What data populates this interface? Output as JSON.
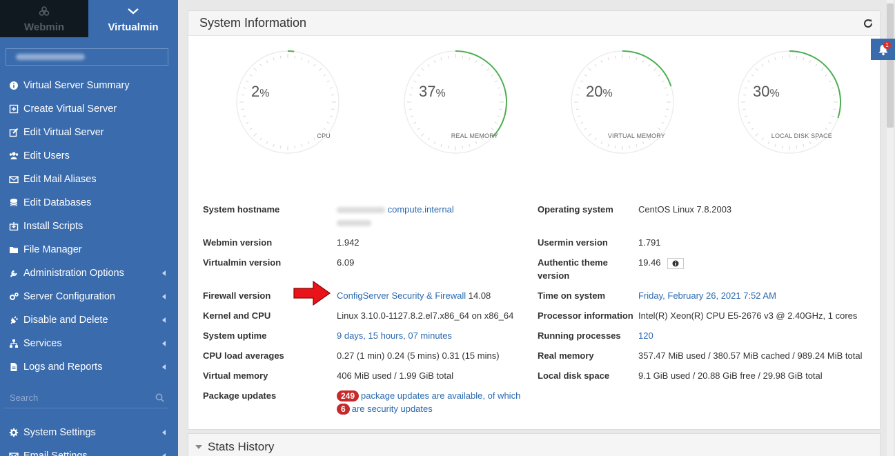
{
  "switcher": {
    "webmin_label": "Webmin",
    "virtualmin_label": "Virtualmin"
  },
  "sidebar": {
    "items": [
      {
        "label": "Virtual Server Summary",
        "icon": "info-circle-icon"
      },
      {
        "label": "Create Virtual Server",
        "icon": "plus-square-icon"
      },
      {
        "label": "Edit Virtual Server",
        "icon": "edit-icon"
      },
      {
        "label": "Edit Users",
        "icon": "users-icon"
      },
      {
        "label": "Edit Mail Aliases",
        "icon": "envelope-icon"
      },
      {
        "label": "Edit Databases",
        "icon": "database-icon"
      },
      {
        "label": "Install Scripts",
        "icon": "download-icon"
      },
      {
        "label": "File Manager",
        "icon": "folder-icon"
      },
      {
        "label": "Administration Options",
        "icon": "wrench-icon"
      },
      {
        "label": "Server Configuration",
        "icon": "cogs-icon"
      },
      {
        "label": "Disable and Delete",
        "icon": "plug-icon"
      },
      {
        "label": "Services",
        "icon": "sitemap-icon"
      },
      {
        "label": "Logs and Reports",
        "icon": "file-icon"
      }
    ],
    "search_placeholder": "Search",
    "items2": [
      {
        "label": "System Settings",
        "icon": "cog-icon"
      },
      {
        "label": "Email Settings",
        "icon": "envelope-icon"
      }
    ]
  },
  "panel": {
    "title": "System Information"
  },
  "gauges": [
    {
      "value": "2",
      "unit": "%",
      "label": "CPU",
      "fraction": 0.02
    },
    {
      "value": "37",
      "unit": "%",
      "label": "REAL MEMORY",
      "fraction": 0.37
    },
    {
      "value": "20",
      "unit": "%",
      "label": "VIRTUAL MEMORY",
      "fraction": 0.2
    },
    {
      "value": "30",
      "unit": "%",
      "label": "LOCAL DISK SPACE",
      "fraction": 0.3
    }
  ],
  "info": {
    "hostname_label": "System hostname",
    "hostname_value": "compute.internal",
    "os_label": "Operating system",
    "os_value": "CentOS Linux 7.8.2003",
    "webmin_label": "Webmin version",
    "webmin_value": "1.942",
    "usermin_label": "Usermin version",
    "usermin_value": "1.791",
    "virtualmin_label": "Virtualmin version",
    "virtualmin_value": "6.09",
    "theme_label_1": "Authentic theme",
    "theme_label_2": "version",
    "theme_value": "19.46",
    "firewall_label": "Firewall version",
    "firewall_link": "ConfigServer Security & Firewall",
    "firewall_version": "14.08",
    "time_label": "Time on system",
    "time_value": "Friday, February 26, 2021 7:52 AM",
    "kernel_label": "Kernel and CPU",
    "kernel_value": "Linux 3.10.0-1127.8.2.el7.x86_64 on x86_64",
    "processor_label": "Processor information",
    "processor_value": "Intel(R) Xeon(R) CPU E5-2676 v3 @ 2.40GHz, 1 cores",
    "uptime_label": "System uptime",
    "uptime_value": "9 days, 15 hours, 07 minutes",
    "processes_label": "Running processes",
    "processes_value": "120",
    "load_label": "CPU load averages",
    "load_value": "0.27 (1 min) 0.24 (5 mins) 0.31 (15 mins)",
    "realmem_label": "Real memory",
    "realmem_value": "357.47 MiB used / 380.57 MiB cached / 989.24 MiB total",
    "virtmem_label": "Virtual memory",
    "virtmem_value": "406 MiB used / 1.99 GiB total",
    "disk_label": "Local disk space",
    "disk_value": "9.1 GiB used / 20.88 GiB free / 29.98 GiB total",
    "packages_label": "Package updates",
    "packages_count": "249",
    "packages_text": "package updates are available, of which",
    "security_count": "6",
    "security_text": "are security updates"
  },
  "stats": {
    "title": "Stats History"
  },
  "notifications": {
    "count": "1"
  },
  "colors": {
    "sidebar": "#3a6bad",
    "gauge": "#4caf50",
    "link": "#2a69b0",
    "badge": "#c72a2a"
  }
}
